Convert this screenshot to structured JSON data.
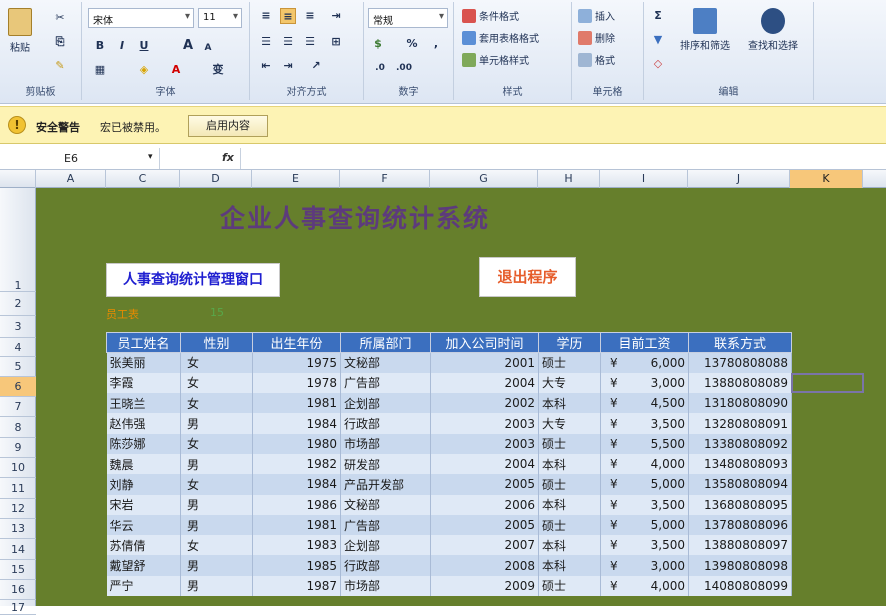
{
  "ribbon": {
    "clipboard": {
      "label": "剪贴板",
      "paste": "粘贴"
    },
    "font": {
      "label": "字体",
      "name": "宋体",
      "size": "11",
      "bold": "B",
      "italic": "I",
      "underline": "U",
      "grow": "A",
      "shrink": "A",
      "wen": "变"
    },
    "alignment": {
      "label": "对齐方式"
    },
    "number": {
      "label": "数字",
      "format": "常规",
      "percent": "%",
      "comma": ","
    },
    "styles": {
      "label": "样式",
      "cond": "条件格式",
      "table": "套用表格格式",
      "cell": "单元格样式"
    },
    "cells": {
      "label": "单元格",
      "insert": "插入",
      "delete": "删除",
      "format": "格式"
    },
    "editing": {
      "label": "编辑",
      "sort": "排序和筛选",
      "find": "查找和选择",
      "sum": "Σ"
    }
  },
  "warning": {
    "title": "安全警告",
    "message": "宏已被禁用。",
    "button": "启用内容"
  },
  "formula": {
    "cell": "E6",
    "fx": "fx"
  },
  "columns": [
    {
      "l": "A",
      "w": 70,
      "sel": false
    },
    {
      "l": "C",
      "w": 74,
      "sel": false
    },
    {
      "l": "D",
      "w": 72,
      "sel": false
    },
    {
      "l": "E",
      "w": 88,
      "sel": false
    },
    {
      "l": "F",
      "w": 90,
      "sel": false
    },
    {
      "l": "G",
      "w": 108,
      "sel": false
    },
    {
      "l": "H",
      "w": 62,
      "sel": false
    },
    {
      "l": "I",
      "w": 88,
      "sel": false
    },
    {
      "l": "J",
      "w": 102,
      "sel": false
    },
    {
      "l": "K",
      "w": 73,
      "sel": true
    }
  ],
  "rows": [
    {
      "n": "1",
      "h": 104,
      "sel": false
    },
    {
      "n": "2",
      "h": 24,
      "sel": false
    },
    {
      "n": "3",
      "h": 22,
      "sel": false
    },
    {
      "n": "4",
      "h": 19,
      "sel": false
    },
    {
      "n": "5",
      "h": 20,
      "sel": false
    },
    {
      "n": "6",
      "h": 20,
      "sel": true
    },
    {
      "n": "7",
      "h": 20,
      "sel": false
    },
    {
      "n": "8",
      "h": 21,
      "sel": false
    },
    {
      "n": "9",
      "h": 20,
      "sel": false
    },
    {
      "n": "10",
      "h": 20,
      "sel": false
    },
    {
      "n": "11",
      "h": 21,
      "sel": false
    },
    {
      "n": "12",
      "h": 20,
      "sel": false
    },
    {
      "n": "13",
      "h": 20,
      "sel": false
    },
    {
      "n": "14",
      "h": 21,
      "sel": false
    },
    {
      "n": "15",
      "h": 20,
      "sel": false
    },
    {
      "n": "16",
      "h": 20,
      "sel": false
    },
    {
      "n": "17",
      "h": 15,
      "sel": false
    }
  ],
  "sheet": {
    "title": "企业人事查询统计系统",
    "query_button": "人事查询统计管理窗口",
    "exit_button": "退出程序",
    "row3_label1": "员工表",
    "row3_label2": "15"
  },
  "table": {
    "headers": [
      "员工姓名",
      "性别",
      "出生年份",
      "所属部门",
      "加入公司时间",
      "学历",
      "目前工资",
      "联系方式"
    ],
    "rows": [
      [
        "张美丽",
        "女",
        "1975",
        "文秘部",
        "2001",
        "硕士",
        "¥",
        "6,000",
        "13780808088"
      ],
      [
        "李霞",
        "女",
        "1978",
        "广告部",
        "2004",
        "大专",
        "¥",
        "3,000",
        "13880808089"
      ],
      [
        "王晓兰",
        "女",
        "1981",
        "企划部",
        "2002",
        "本科",
        "¥",
        "4,500",
        "13180808090"
      ],
      [
        "赵伟强",
        "男",
        "1984",
        "行政部",
        "2003",
        "大专",
        "¥",
        "3,500",
        "13280808091"
      ],
      [
        "陈莎娜",
        "女",
        "1980",
        "市场部",
        "2003",
        "硕士",
        "¥",
        "5,500",
        "13380808092"
      ],
      [
        "魏晨",
        "男",
        "1982",
        "研发部",
        "2004",
        "本科",
        "¥",
        "4,000",
        "13480808093"
      ],
      [
        "刘静",
        "女",
        "1984",
        "产品开发部",
        "2005",
        "硕士",
        "¥",
        "5,000",
        "13580808094"
      ],
      [
        "宋岩",
        "男",
        "1986",
        "文秘部",
        "2006",
        "本科",
        "¥",
        "3,500",
        "13680808095"
      ],
      [
        "华云",
        "男",
        "1981",
        "广告部",
        "2005",
        "硕士",
        "¥",
        "5,000",
        "13780808096"
      ],
      [
        "苏倩倩",
        "女",
        "1983",
        "企划部",
        "2007",
        "本科",
        "¥",
        "3,500",
        "13880808097"
      ],
      [
        "戴望舒",
        "男",
        "1985",
        "行政部",
        "2008",
        "本科",
        "¥",
        "3,000",
        "13980808098"
      ],
      [
        "严宁",
        "男",
        "1987",
        "市场部",
        "2009",
        "硕士",
        "¥",
        "4,000",
        "14080808099"
      ]
    ]
  }
}
